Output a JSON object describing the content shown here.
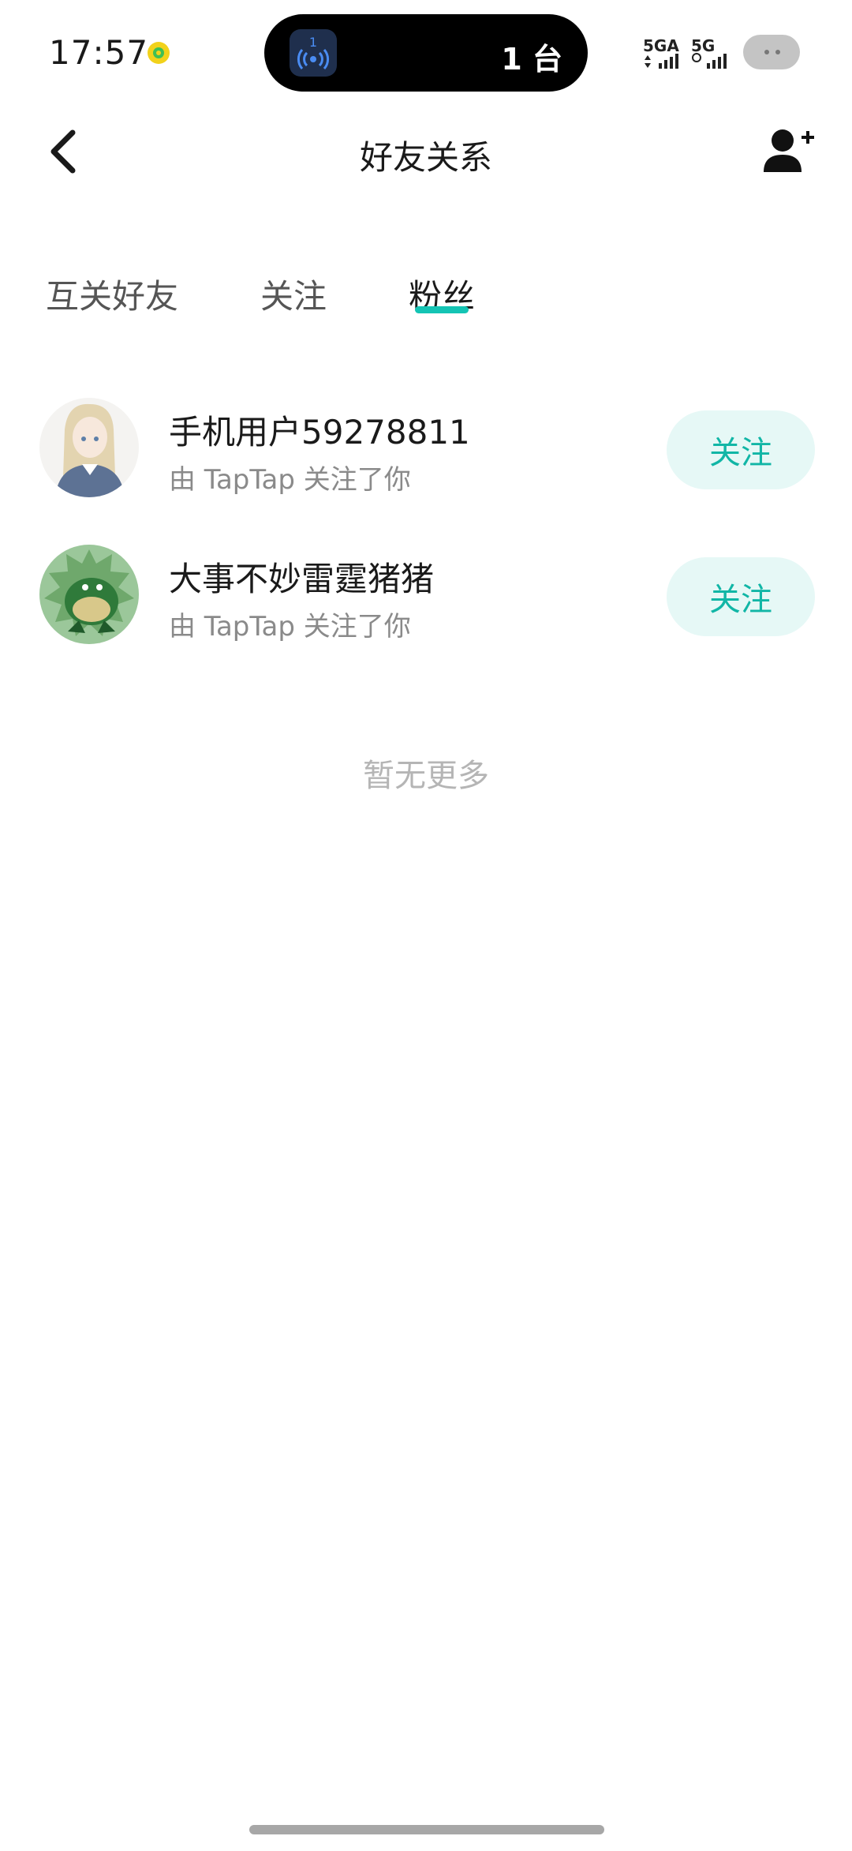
{
  "status_bar": {
    "time": "17:57",
    "island_badge": "1",
    "island_count": "1 台",
    "net1": "5GA",
    "net2": "5G"
  },
  "nav": {
    "title": "好友关系",
    "back_icon": "chevron-left-icon",
    "add_icon": "add-user-icon"
  },
  "tabs": [
    {
      "label": "互关好友",
      "active": false
    },
    {
      "label": "关注",
      "active": false
    },
    {
      "label": "粉丝",
      "active": true
    }
  ],
  "followers": [
    {
      "name": "手机用户59278811",
      "subtitle": "由 TapTap 关注了你",
      "button": "关注"
    },
    {
      "name": "大事不妙雷霆猪猪",
      "subtitle": "由 TapTap 关注了你",
      "button": "关注"
    }
  ],
  "empty_hint": "暂无更多",
  "colors": {
    "accent": "#14c4b4",
    "button_bg": "#e6f8f6",
    "button_text": "#11b6a6"
  }
}
